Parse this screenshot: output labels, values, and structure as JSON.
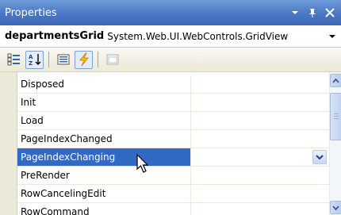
{
  "window": {
    "title": "Properties"
  },
  "object_selector": {
    "object_name": "departmentsGrid",
    "object_type": "System.Web.UI.WebControls.GridView"
  },
  "toolbar": {
    "buttons": [
      {
        "name": "categorized",
        "icon": "categorized-icon",
        "active": false
      },
      {
        "name": "alphabetical",
        "icon": "alphabetical-sort-icon",
        "active": true
      },
      {
        "name": "properties",
        "icon": "properties-icon",
        "active": false
      },
      {
        "name": "events",
        "icon": "lightning-bolt-icon",
        "active": true
      },
      {
        "name": "property-pages",
        "icon": "property-pages-icon",
        "active": false
      }
    ]
  },
  "events": [
    {
      "name": "Disposed",
      "value": ""
    },
    {
      "name": "Init",
      "value": ""
    },
    {
      "name": "Load",
      "value": ""
    },
    {
      "name": "PageIndexChanged",
      "value": ""
    },
    {
      "name": "PageIndexChanging",
      "value": "",
      "selected": true
    },
    {
      "name": "PreRender",
      "value": ""
    },
    {
      "name": "RowCancelingEdit",
      "value": ""
    },
    {
      "name": "RowCommand",
      "value": ""
    }
  ],
  "colors": {
    "title_bar": "#4a76c4",
    "selection": "#316ac5",
    "toolbar_bg": "#ece9d8"
  }
}
